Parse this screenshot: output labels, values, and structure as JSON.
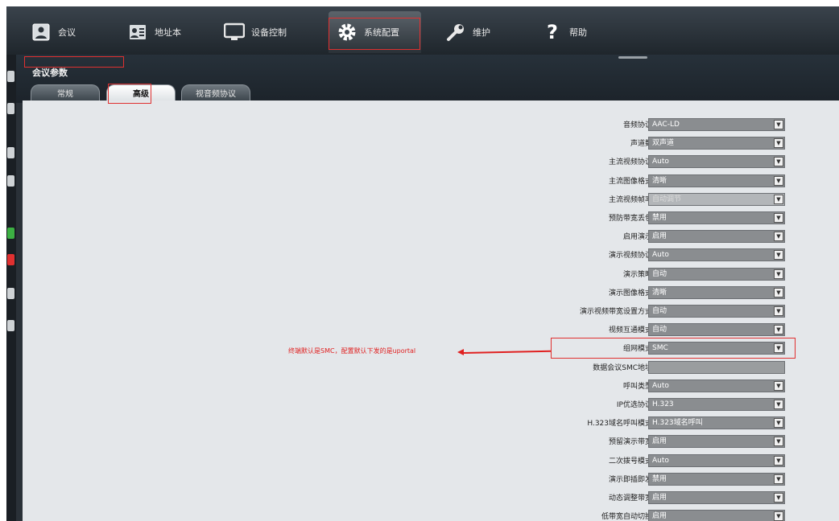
{
  "nav": {
    "items": [
      {
        "label": "会议",
        "icon": "conference-icon"
      },
      {
        "label": "地址本",
        "icon": "address-book-icon"
      },
      {
        "label": "设备控制",
        "icon": "monitor-icon"
      },
      {
        "label": "系统配置",
        "icon": "gear-icon"
      },
      {
        "label": "维护",
        "icon": "wrench-icon"
      },
      {
        "label": "帮助",
        "icon": "help-icon"
      }
    ],
    "active_index": 3
  },
  "section_title": "会议参数",
  "tabs": [
    {
      "label": "常规"
    },
    {
      "label": "高级"
    },
    {
      "label": "视音频协议"
    }
  ],
  "active_tab": 1,
  "settings": [
    {
      "label": "音频协议",
      "value": "AAC-LD"
    },
    {
      "label": "声道数",
      "value": "双声道"
    },
    {
      "label": "主流视频协议",
      "value": "Auto"
    },
    {
      "label": "主流图像格式",
      "value": "清晰"
    },
    {
      "label": "主流视频帧率",
      "value": "自动调节",
      "disabled": true
    },
    {
      "label": "预防带宽丢包",
      "value": "禁用"
    },
    {
      "label": "启用演示",
      "value": "启用"
    },
    {
      "label": "演示视频协议",
      "value": "Auto"
    },
    {
      "label": "演示策略",
      "value": "自动"
    },
    {
      "label": "演示图像格式",
      "value": "清晰"
    },
    {
      "label": "演示视频带宽设置方式",
      "value": "自动"
    },
    {
      "label": "视频互通模式",
      "value": "自动"
    },
    {
      "label": "组网模式",
      "value": "SMC"
    },
    {
      "label": "数据会议SMC地址",
      "value": "",
      "textbox": true
    },
    {
      "label": "呼叫类型",
      "value": "Auto"
    },
    {
      "label": "IP优选协议",
      "value": "H.323"
    },
    {
      "label": "H.323域名呼叫模式",
      "value": "H.323域名呼叫"
    },
    {
      "label": "预留演示带宽",
      "value": "启用"
    },
    {
      "label": "二次拨号模式",
      "value": "Auto"
    },
    {
      "label": "演示即插即发",
      "value": "禁用"
    },
    {
      "label": "动态调整带宽",
      "value": "启用"
    },
    {
      "label": "低带宽自动切换",
      "value": "启用"
    }
  ],
  "annotation": "终端默认是SMC，配置默认下发的是uportal",
  "colors": {
    "highlight": "#e03030",
    "nav_bg": "#2a3138",
    "content_bg": "#e4e7ea",
    "select_bg": "#8a8d90"
  }
}
